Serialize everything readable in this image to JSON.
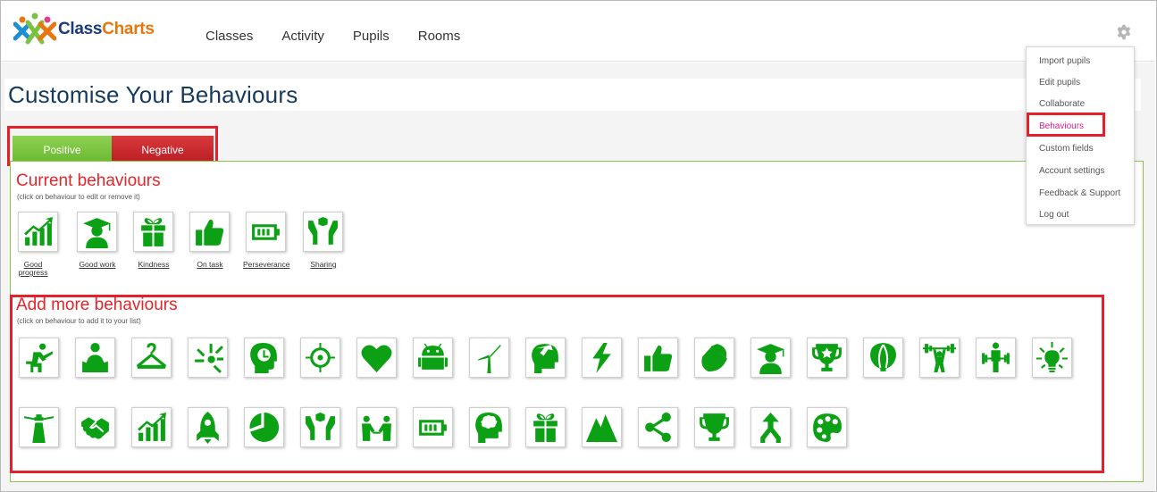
{
  "brand": {
    "name_part1": "Class",
    "name_part2": "Charts"
  },
  "nav": {
    "items": [
      "Classes",
      "Activity",
      "Pupils",
      "Rooms"
    ]
  },
  "page": {
    "title": "Customise Your Behaviours"
  },
  "tabs": {
    "positive": "Positive",
    "negative": "Negative"
  },
  "current": {
    "title": "Current behaviours",
    "hint": "(click on behaviour to edit or remove it)",
    "items": [
      {
        "label": "Good progress",
        "icon": "chart-growth-icon"
      },
      {
        "label": "Good work",
        "icon": "graduate-icon"
      },
      {
        "label": "Kindness",
        "icon": "gift-icon"
      },
      {
        "label": "On task",
        "icon": "thumbs-up-icon"
      },
      {
        "label": "Perseverance",
        "icon": "battery-icon"
      },
      {
        "label": "Sharing",
        "icon": "hands-cube-icon"
      }
    ]
  },
  "add": {
    "title": "Add more behaviours",
    "hint": "(click on behaviour to add it to your list)",
    "row1": [
      "desk-person-icon",
      "reading-person-icon",
      "hanger-icon",
      "burst-icon",
      "head-clock-icon",
      "target-icon",
      "heart-icon",
      "android-icon",
      "wind-turbine-icon",
      "head-arrow-icon",
      "lightning-icon",
      "thumbs-up-icon",
      "acorn-icon",
      "graduate-icon",
      "trophy-star-icon",
      "balloon-icon",
      "weightlifter-icon",
      "dumbbell-person-icon",
      "lightbulb-icon"
    ],
    "row2": [
      "lighthouse-icon",
      "handshake-icon",
      "chart-growth-icon",
      "rocket-icon",
      "pie-chart-icon",
      "hands-cube-icon",
      "people-meeting-icon",
      "battery-icon",
      "brain-head-icon",
      "gift-icon",
      "mountain-icon",
      "share-icon",
      "trophy-icon",
      "merge-arrow-icon",
      "palette-icon"
    ]
  },
  "menu": {
    "items": [
      "Import pupils",
      "Edit pupils",
      "Collaborate",
      "Behaviours",
      "Custom fields",
      "Account settings",
      "Feedback & Support",
      "Log out"
    ],
    "active": "Behaviours"
  },
  "colors": {
    "icon_green": "#0ca014",
    "positive": "#7cc242",
    "negative": "#c8282d",
    "highlight": "#e3212b",
    "title": "#163a5c"
  }
}
